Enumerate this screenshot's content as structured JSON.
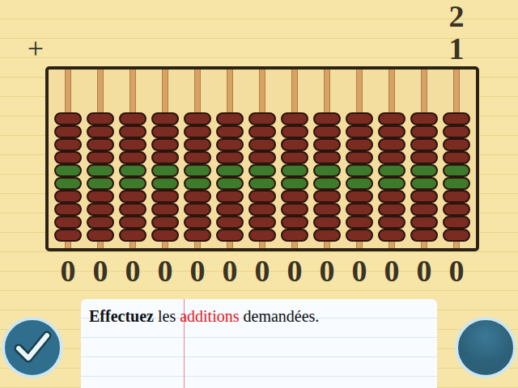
{
  "operator": "+",
  "operands": [
    "2",
    "1"
  ],
  "beads": [
    {
      "color": "#7a2b22"
    },
    {
      "color": "#7a2b22"
    },
    {
      "color": "#7a2b22"
    },
    {
      "color": "#7a2b22"
    },
    {
      "color": "#3e7a2c"
    },
    {
      "color": "#3e7a2c"
    },
    {
      "color": "#7a2b22"
    },
    {
      "color": "#7a2b22"
    },
    {
      "color": "#7a2b22"
    },
    {
      "color": "#7a2b22"
    }
  ],
  "rods": [
    {
      "value": "0",
      "level": 0
    },
    {
      "value": "0",
      "level": 0
    },
    {
      "value": "0",
      "level": 0
    },
    {
      "value": "0",
      "level": 0
    },
    {
      "value": "0",
      "level": 0
    },
    {
      "value": "0",
      "level": 0
    },
    {
      "value": "0",
      "level": 0
    },
    {
      "value": "0",
      "level": 0
    },
    {
      "value": "0",
      "level": 0
    },
    {
      "value": "0",
      "level": 0
    },
    {
      "value": "0",
      "level": 0
    },
    {
      "value": "0",
      "level": 0
    },
    {
      "value": "0",
      "level": 0
    }
  ],
  "instruction": [
    {
      "text": "Effectuez",
      "kind": "bold"
    },
    {
      "text": "les",
      "kind": "plain"
    },
    {
      "text": "additions",
      "kind": "highlight"
    },
    {
      "text": "demandées.",
      "kind": "plain"
    }
  ]
}
